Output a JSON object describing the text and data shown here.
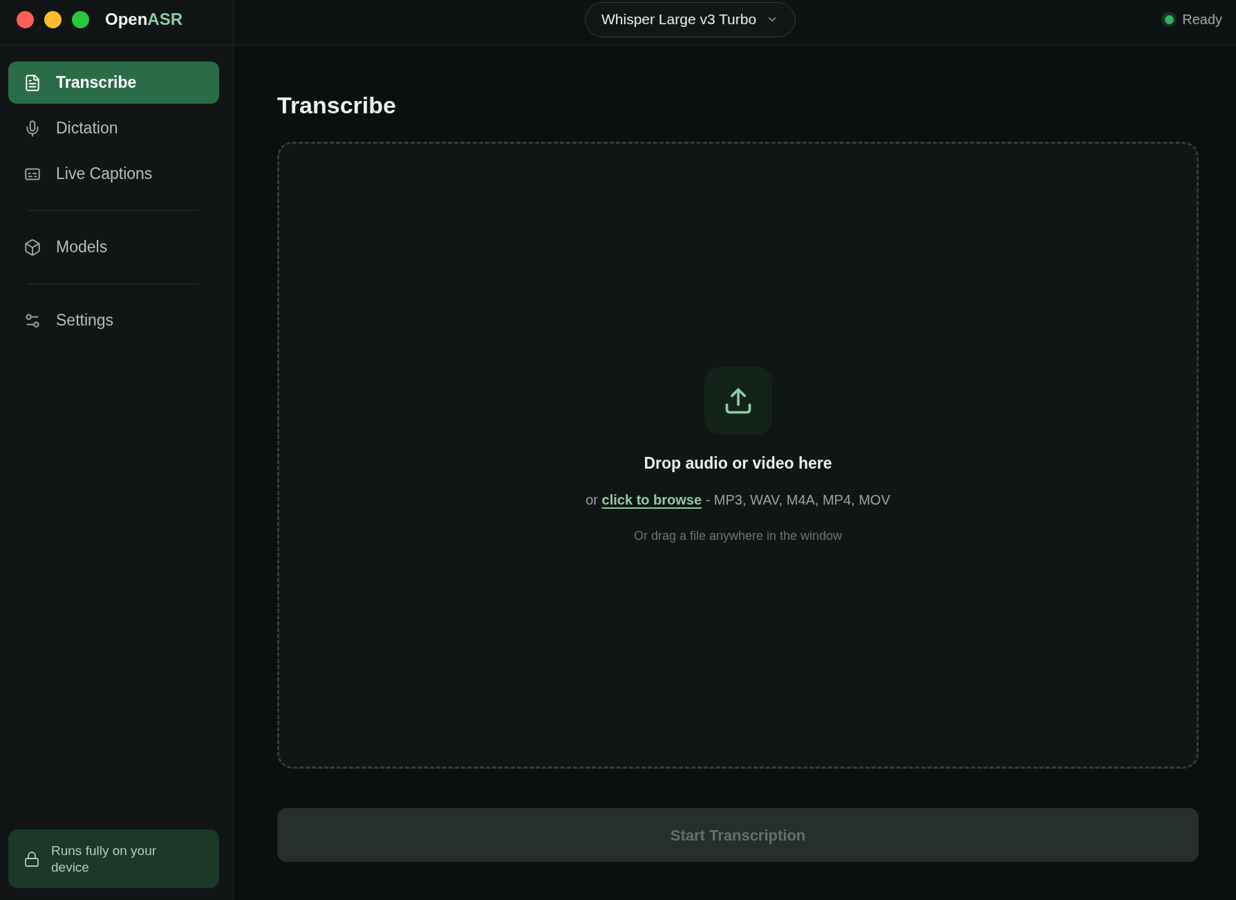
{
  "app": {
    "name": "Open",
    "name_accent": "ASR"
  },
  "model_selector": {
    "value": "Whisper Large v3 Turbo"
  },
  "status": {
    "label": "Ready",
    "active": true
  },
  "sidebar": {
    "groups": [
      {
        "items": [
          {
            "label": "Transcribe",
            "selected": true
          },
          {
            "label": "Dictation",
            "selected": false
          },
          {
            "label": "Live Captions",
            "selected": false
          }
        ]
      },
      {
        "items": [
          {
            "label": "Models",
            "selected": false
          }
        ]
      },
      {
        "items": [
          {
            "label": "Settings",
            "selected": false
          }
        ]
      }
    ],
    "privacy_note": "Runs fully on your device"
  },
  "page": {
    "title": "Transcribe"
  },
  "dropzone": {
    "heading": "Drop audio or video here",
    "prefix": "or",
    "link": "click to browse",
    "formats": "- MP3, WAV, M4A, MP4, MOV",
    "hint": "Or drag a file anywhere in the window"
  },
  "start_button": {
    "label": "Start Transcription",
    "disabled": true
  }
}
